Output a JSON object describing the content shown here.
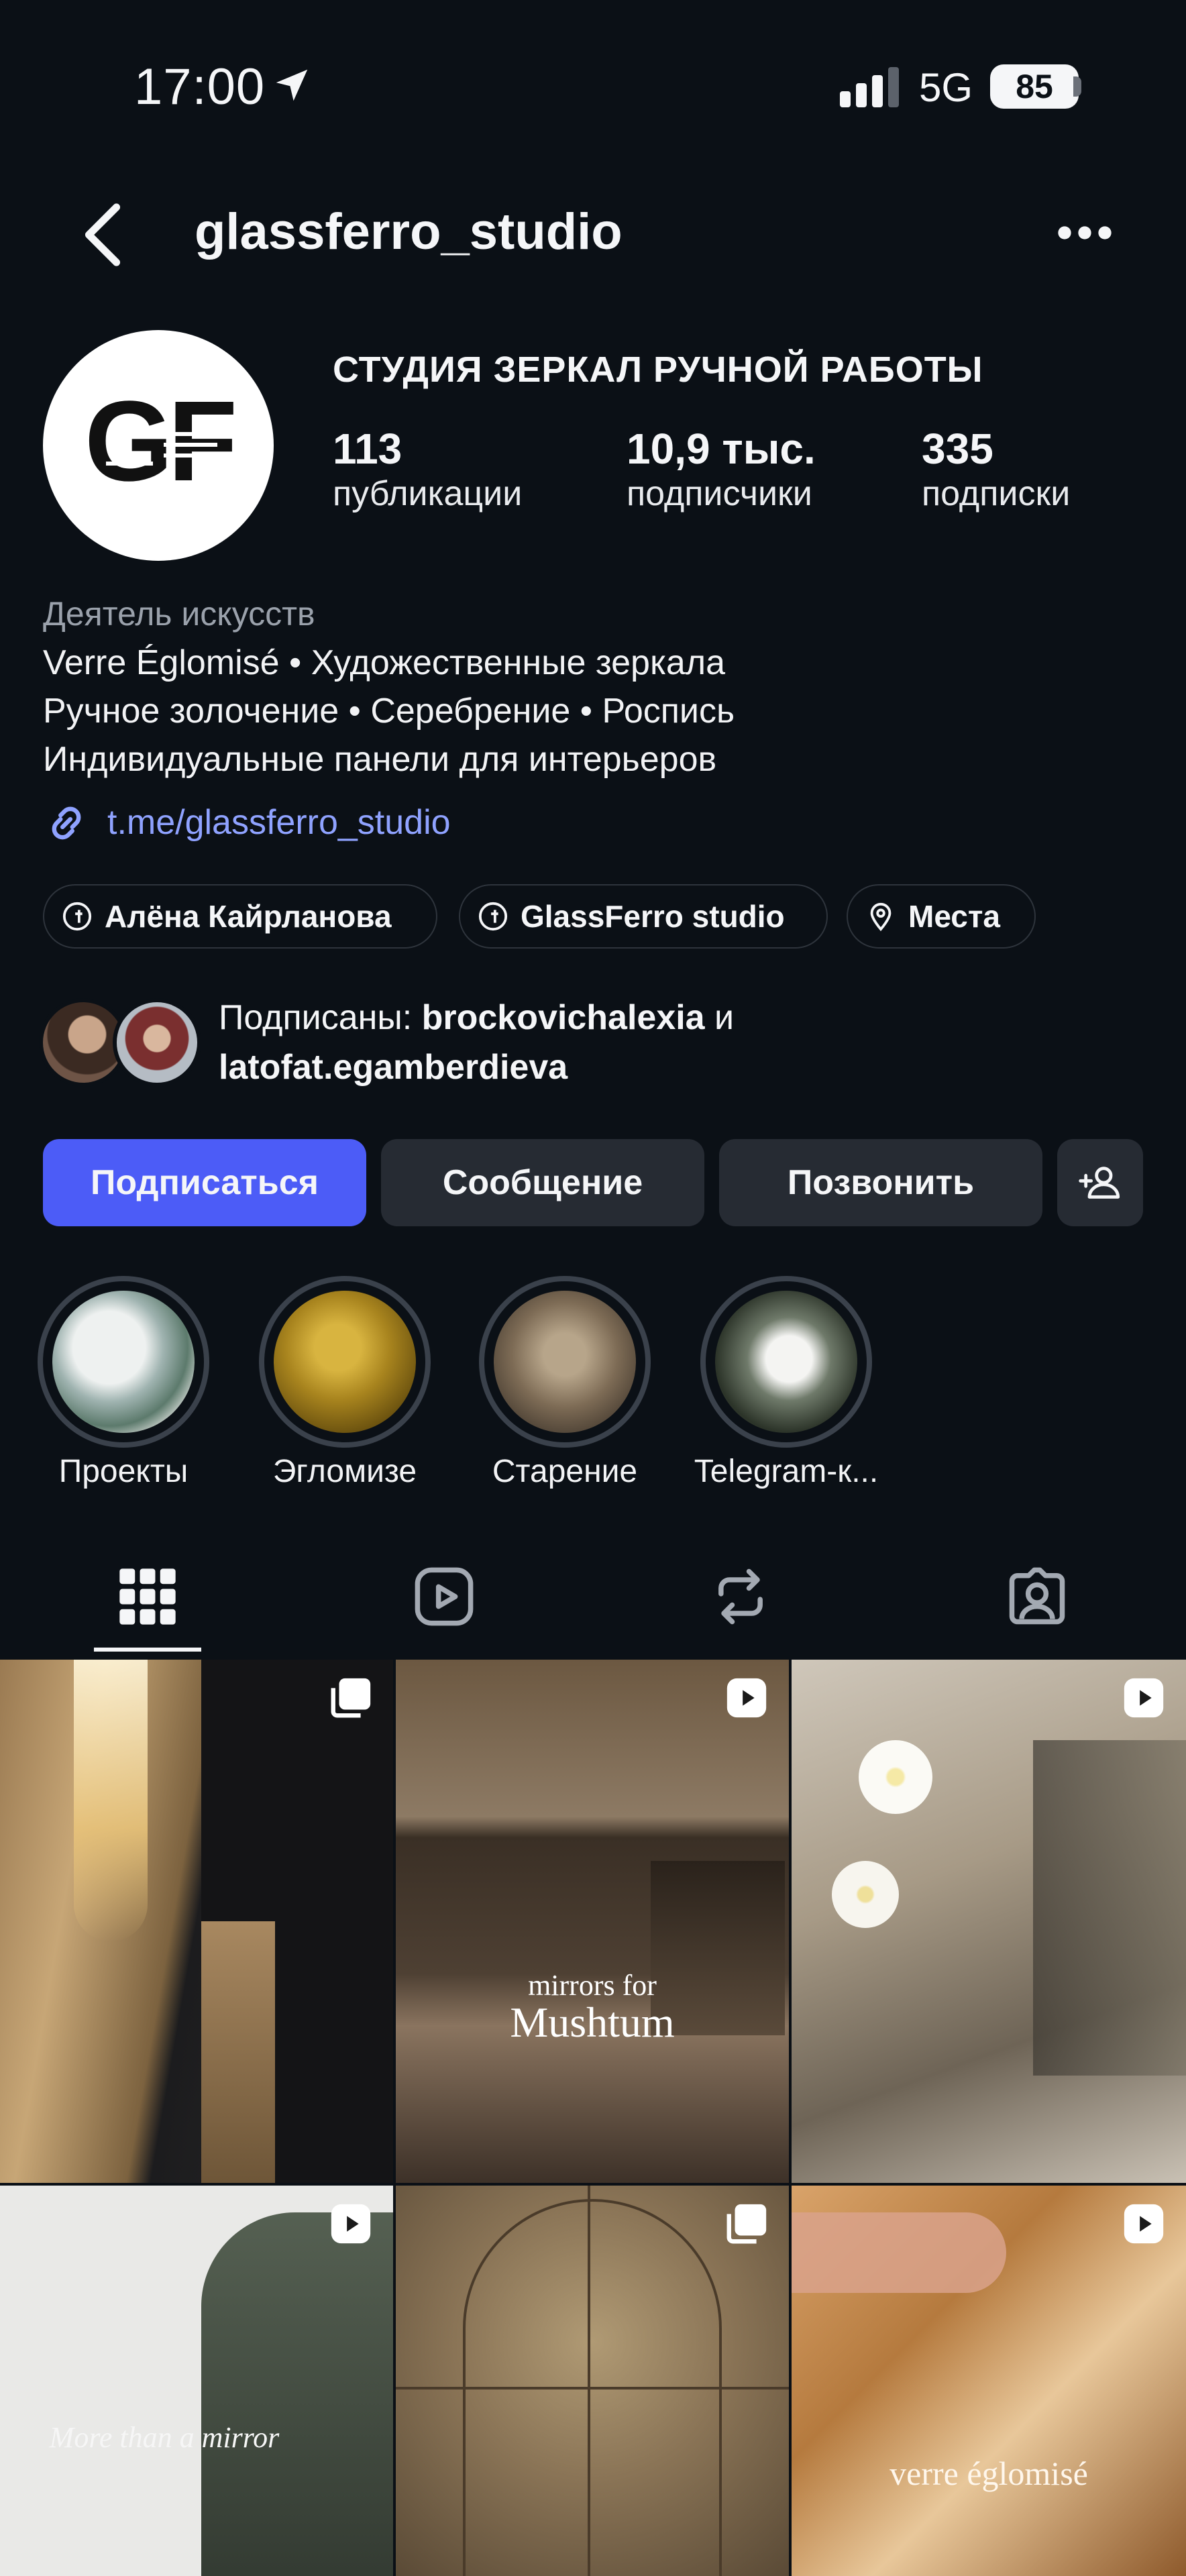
{
  "status_bar": {
    "time": "17:00",
    "network": "5G",
    "battery": "85"
  },
  "header": {
    "username": "glassferro_studio"
  },
  "profile": {
    "avatar_text": "GF",
    "name": "СТУДИЯ ЗЕРКАЛ РУЧНОЙ РАБОТЫ",
    "stats": [
      {
        "value": "113",
        "label": "публикации"
      },
      {
        "value": "10,9 тыс.",
        "label": "подписчики"
      },
      {
        "value": "335",
        "label": "подписки"
      }
    ],
    "category": "Деятель искусств",
    "bio_lines": [
      "Verre Églomisé • Художественные зеркала",
      "Ручное золочение • Серебрение • Роспись",
      "Индивидуальные панели для интерьеров"
    ],
    "link": "t.me/glassferro_studio"
  },
  "chips": [
    {
      "label": "Алёна Кайрланова",
      "icon": "threads-icon"
    },
    {
      "label": "GlassFerro studio",
      "icon": "threads-icon"
    },
    {
      "label": "Места",
      "icon": "location-pin-icon"
    }
  ],
  "mutual": {
    "prefix": "Подписаны: ",
    "user1": "brockovichalexia",
    "conj": " и",
    "user2": "latofat.egamberdieva"
  },
  "actions": {
    "follow": "Подписаться",
    "message": "Сообщение",
    "call": "Позвонить"
  },
  "highlights": [
    {
      "label": "Проекты"
    },
    {
      "label": "Эгломизе"
    },
    {
      "label": "Старение"
    },
    {
      "label": "Telegram-к..."
    }
  ],
  "tabs": [
    "grid-icon",
    "reels-icon",
    "reposts-icon",
    "tagged-icon"
  ],
  "posts": [
    {
      "badge": "carousel-icon",
      "overlay": ""
    },
    {
      "badge": "reel-icon",
      "overlay_line1": "mirrors for",
      "overlay_line2": "Mushtum"
    },
    {
      "badge": "reel-icon",
      "overlay": ""
    },
    {
      "badge": "reel-icon",
      "overlay": "More than a mirror"
    },
    {
      "badge": "carousel-icon",
      "overlay": ""
    },
    {
      "badge": "reel-icon",
      "overlay": "verre églomisé"
    }
  ],
  "colors": {
    "background": "#0b1016",
    "primary_button": "#4c5cf7",
    "secondary_button": "#262b33",
    "link": "#8fa2ff"
  }
}
